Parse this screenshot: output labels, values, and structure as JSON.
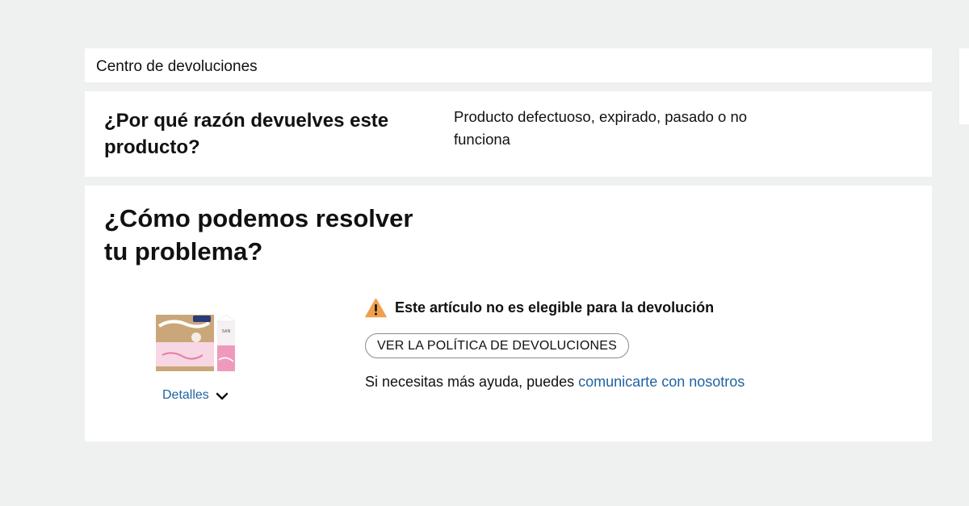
{
  "header": {
    "title": "Centro de devoluciones"
  },
  "reason": {
    "question": "¿Por qué razón devuelves este producto?",
    "answer": "Producto defectuoso, expirado, pasado o no funciona"
  },
  "resolve": {
    "title": "¿Cómo podemos resolver tu problema?",
    "product": {
      "image_icon": "product-pack-image",
      "details_label": "Detalles"
    },
    "eligibility": {
      "icon": "warning-icon",
      "text": "Este artículo no es elegible para la devolución"
    },
    "policy_button": "VER LA POLÍTICA DE DEVOLUCIONES",
    "help": {
      "prefix": "Si necesitas más ayuda, puedes ",
      "link": "comunicarte con nosotros"
    }
  },
  "colors": {
    "background": "#eff0f0",
    "link": "#2162a1",
    "warning": "#f0a04b"
  }
}
